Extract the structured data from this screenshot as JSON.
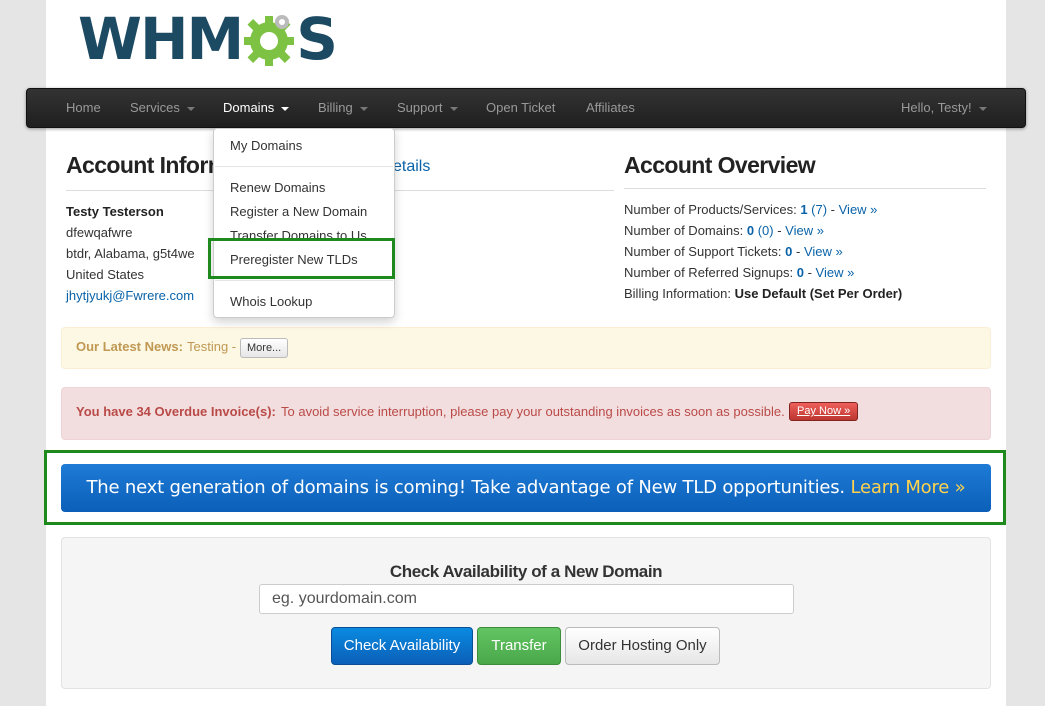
{
  "brand": {
    "logo_text_left": "WHM",
    "logo_text_right": "S"
  },
  "colors": {
    "accent_blue": "#0a63a8",
    "highlight_green": "#1e8a1e",
    "banner_blue": "#1e7bd6",
    "learn_more": "#ffd34d"
  },
  "nav": {
    "items": [
      {
        "label": "Home"
      },
      {
        "label": "Services"
      },
      {
        "label": "Domains"
      },
      {
        "label": "Billing"
      },
      {
        "label": "Support"
      },
      {
        "label": "Open Ticket"
      },
      {
        "label": "Affiliates"
      }
    ],
    "user_menu": "Hello, Testy!"
  },
  "domains_menu": {
    "items": [
      {
        "label": "My Domains"
      },
      {
        "label": "Renew Domains"
      },
      {
        "label": "Register a New Domain"
      },
      {
        "label": "Transfer Domains to Us"
      },
      {
        "label": "Preregister New TLDs"
      },
      {
        "label": "Whois Lookup"
      }
    ]
  },
  "account_info": {
    "title": "Account Inform",
    "update_link": "etails",
    "name": "Testy Testerson",
    "address1": "dfewqafwre",
    "address2": "btdr, Alabama, g5t4we",
    "country": "United States",
    "email": "jhytjyukj@Fwrere.com"
  },
  "account_overview": {
    "title": "Account Overview",
    "products_label": "Number of Products/Services:",
    "products_count": "1",
    "products_total": "(7)",
    "domains_label": "Number of Domains:",
    "domains_count": "0",
    "domains_total": "(0)",
    "tickets_label": "Number of Support Tickets:",
    "tickets_count": "0",
    "referrals_label": "Number of Referred Signups:",
    "referrals_count": "0",
    "billing_label": "Billing Information:",
    "billing_value": "Use Default (Set Per Order)",
    "view_link": "View »",
    "sep": " - "
  },
  "news": {
    "label": "Our Latest News:",
    "text": "Testing -",
    "more_button": "More..."
  },
  "overdue": {
    "label": "You have 34 Overdue Invoice(s):",
    "text": "To avoid service interruption, please pay your outstanding invoices as soon as possible.",
    "pay_button": "Pay Now »"
  },
  "tld_banner": {
    "text": "The next generation of domains is coming! Take advantage of New TLD opportunities.",
    "link": "Learn More »"
  },
  "domain_checker": {
    "title": "Check Availability of a New Domain",
    "placeholder": "eg. yourdomain.com",
    "check_button": "Check Availability",
    "transfer_button": "Transfer",
    "hosting_button": "Order Hosting Only"
  }
}
